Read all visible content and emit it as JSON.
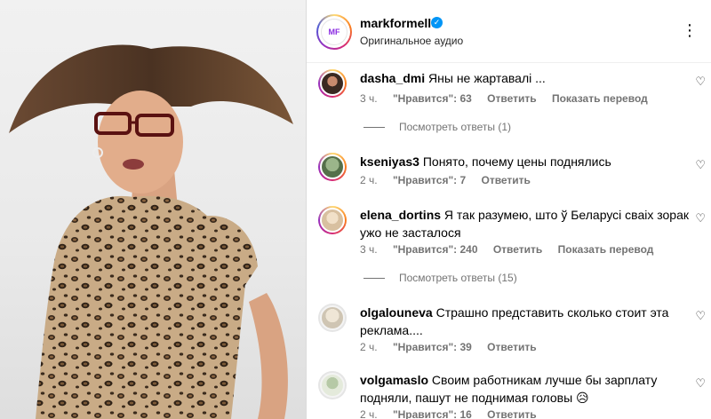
{
  "post": {
    "username": "markformelle",
    "audio": "Оригинальное аудио",
    "logo_text": "MF",
    "more_icon": "more-horizontal-icon"
  },
  "comments": [
    {
      "username": "dasha_dmi",
      "text": "Яны не жартавалі ...",
      "time": "3 ч.",
      "likes": "\"Нравится\": 63",
      "reply": "Ответить",
      "translate": "Показать перевод",
      "view_replies": "Посмотреть ответы (1)"
    },
    {
      "username": "kseniyas3",
      "text": "Понято, почему цены поднялись",
      "time": "2 ч.",
      "likes": "\"Нравится\": 7",
      "reply": "Ответить"
    },
    {
      "username": "elena_dortins",
      "text": "Я так разумею, што ў Беларусі сваіх зорак ужо не засталося",
      "time": "3 ч.",
      "likes": "\"Нравится\": 240",
      "reply": "Ответить",
      "translate": "Показать перевод",
      "view_replies": "Посмотреть ответы (15)"
    },
    {
      "username": "olgalouneva",
      "text": "Страшно представить сколько стоит эта реклама....",
      "time": "2 ч.",
      "likes": "\"Нравится\": 39",
      "reply": "Ответить"
    },
    {
      "username": "volgamaslo",
      "text": "Своим работникам лучше бы зарплату подняли, пашут не поднимая головы 😥",
      "time": "2 ч.",
      "likes": "\"Нравится\": 16",
      "reply": "Ответить"
    }
  ],
  "colors": {
    "verified": "#0095f6",
    "meta": "#737373",
    "divider": "#dbdbdb"
  }
}
